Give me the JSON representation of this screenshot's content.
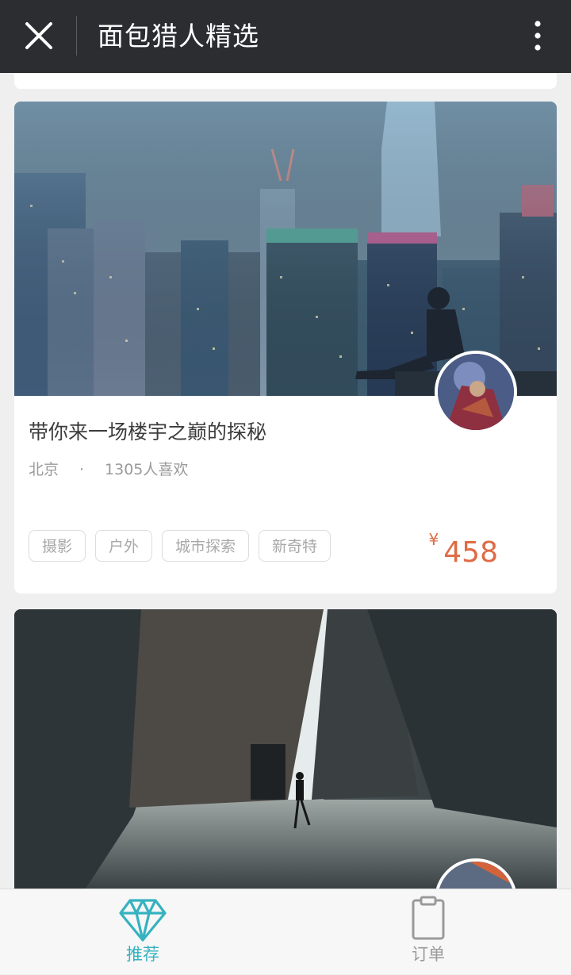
{
  "header": {
    "title": "面包猎人精选",
    "close_icon": "close-icon",
    "more_icon": "more-vertical-icon"
  },
  "cards": [
    {
      "title": "带你来一场楼宇之巅的探秘",
      "location": "北京",
      "separator": "·",
      "likes": "1305人喜欢",
      "tags": [
        "摄影",
        "户外",
        "城市探索",
        "新奇特"
      ],
      "currency": "¥",
      "price": "458"
    }
  ],
  "bottom_nav": {
    "items": [
      {
        "label": "推荐",
        "icon": "diamond-icon",
        "active": true
      },
      {
        "label": "订单",
        "icon": "clipboard-icon",
        "active": false
      }
    ]
  },
  "colors": {
    "accent": "#35b2bf",
    "price": "#e06a44",
    "header_bg": "#2b2d31"
  }
}
